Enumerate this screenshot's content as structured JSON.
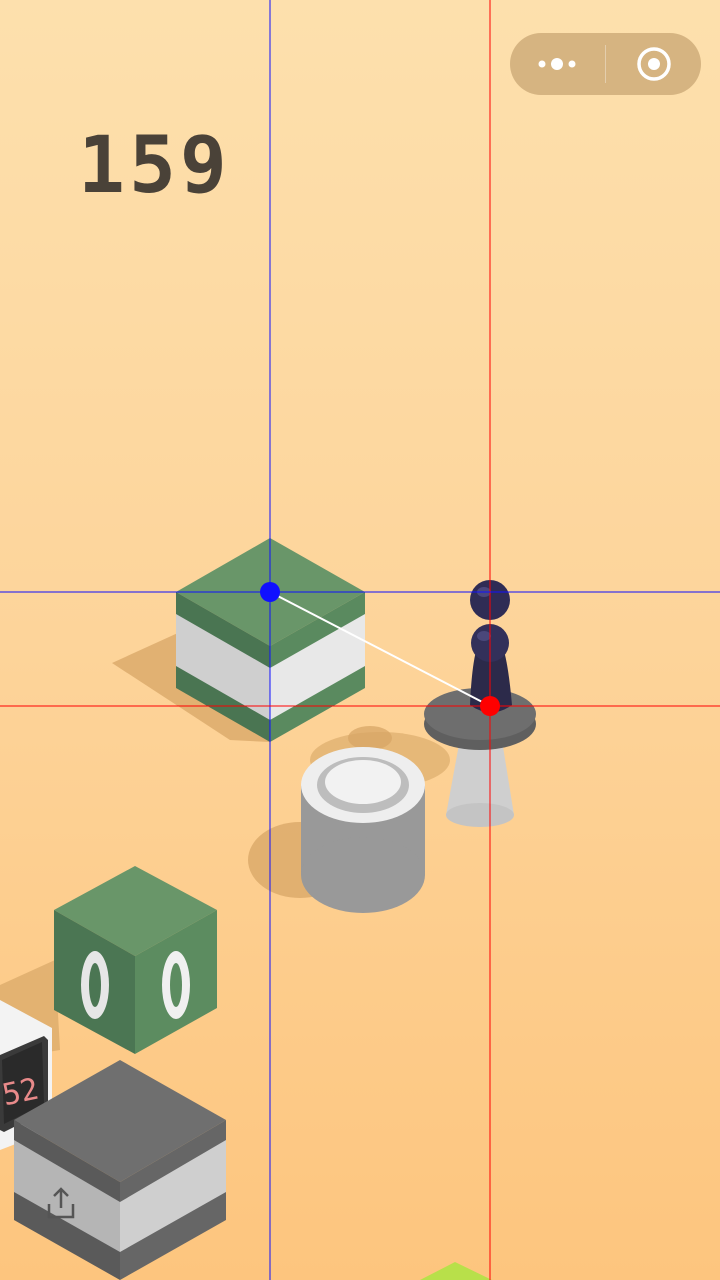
{
  "game": {
    "score": "159",
    "countdown_display": "52"
  },
  "capsule": {
    "more_icon": "more-dots-icon",
    "close_icon": "target-circle-icon"
  },
  "share_icon": "share-upload-icon",
  "colors": {
    "background_top": "#fde0ad",
    "background_bottom": "#fdc57e",
    "score_text": "#4a4238",
    "green_block": "#699669",
    "player": "#2c2a4a",
    "guide_blue": "#1010ff",
    "guide_red": "#ff0000"
  }
}
